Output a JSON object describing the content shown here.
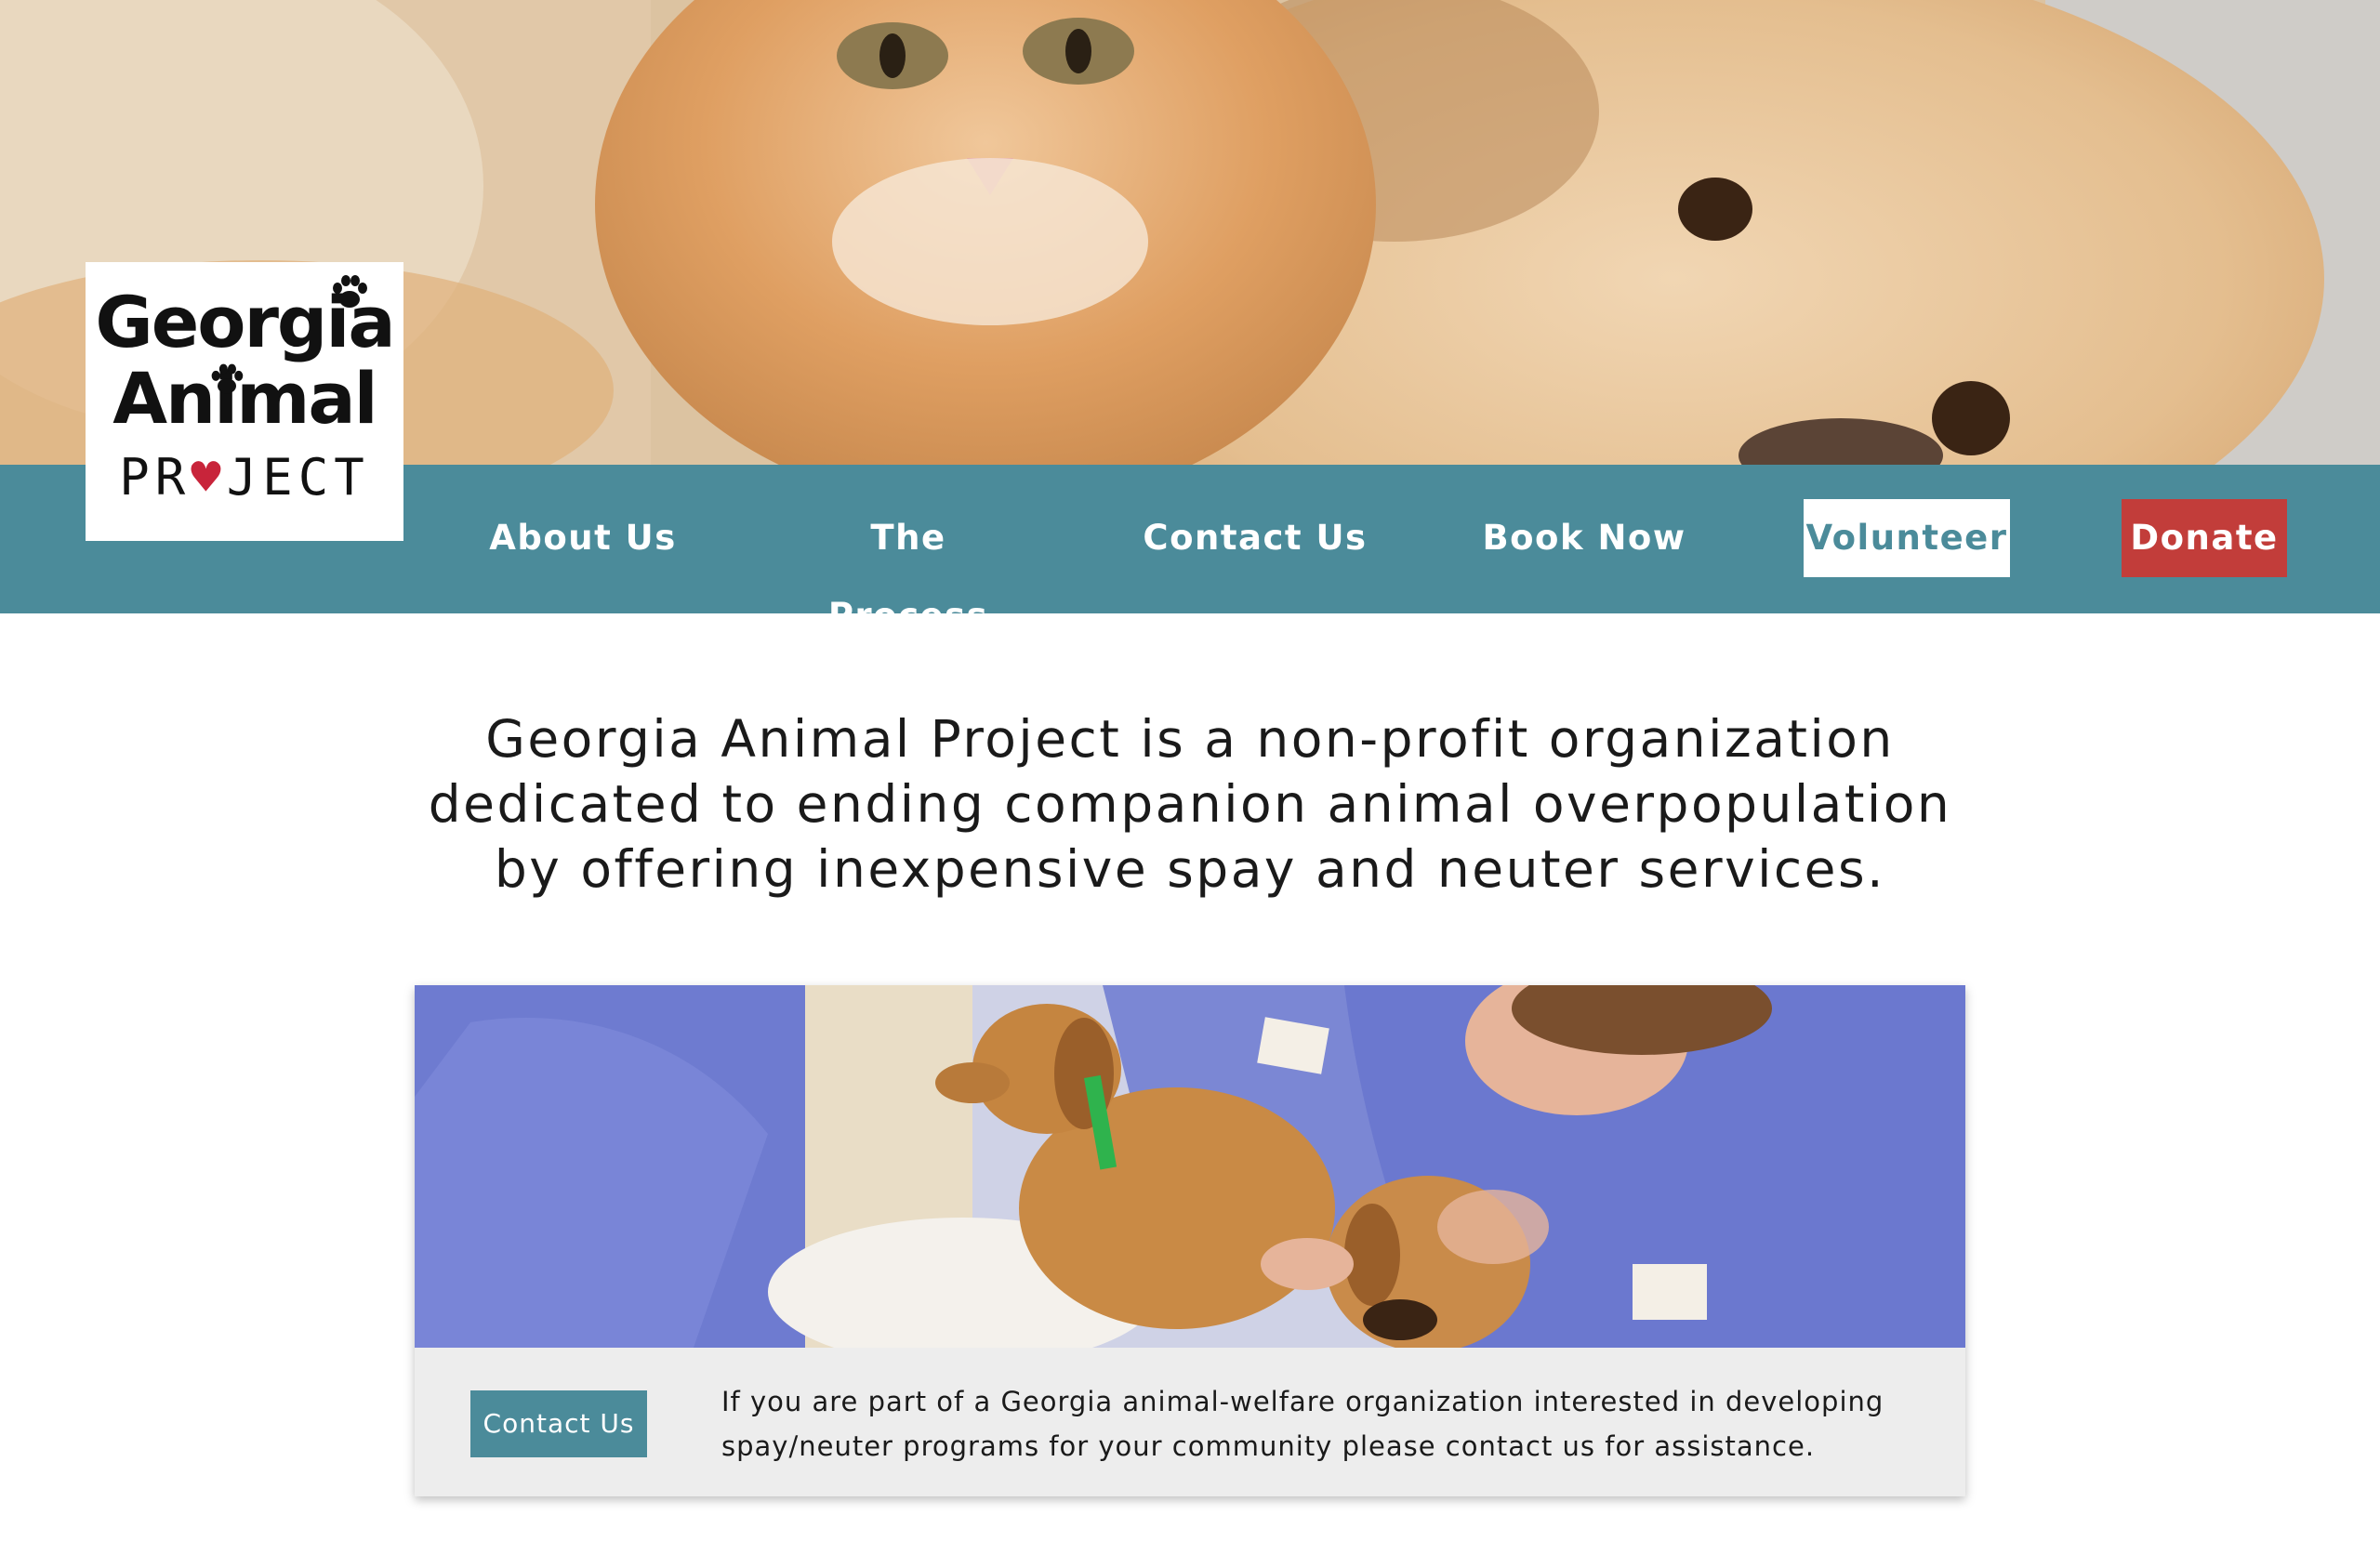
{
  "logo": {
    "line1": "Georgia",
    "line2": "Animal",
    "line3_a": "PR",
    "line3_heart": "♥",
    "line3_b": "JECT"
  },
  "nav": {
    "about": "About Us",
    "process": "The Process",
    "contact": "Contact Us",
    "book": "Book Now",
    "volunteer": "Volunteer",
    "donate": "Donate"
  },
  "mission": {
    "text": "Georgia Animal Project is a non-profit organization dedicated to ending companion animal overpopulation by offering inexpensive spay and neuter services."
  },
  "card": {
    "button_label": "Contact Us",
    "body": "If you are part of a Georgia animal-welfare organization interested in developing spay/neuter programs for your community please contact us for assistance."
  },
  "colors": {
    "teal": "#4b8b9a",
    "donate_red": "#c23d3a",
    "card_bg": "#ededed"
  },
  "icons": {
    "logo_paw": "paw-print-icon",
    "logo_heart": "heart-icon"
  }
}
